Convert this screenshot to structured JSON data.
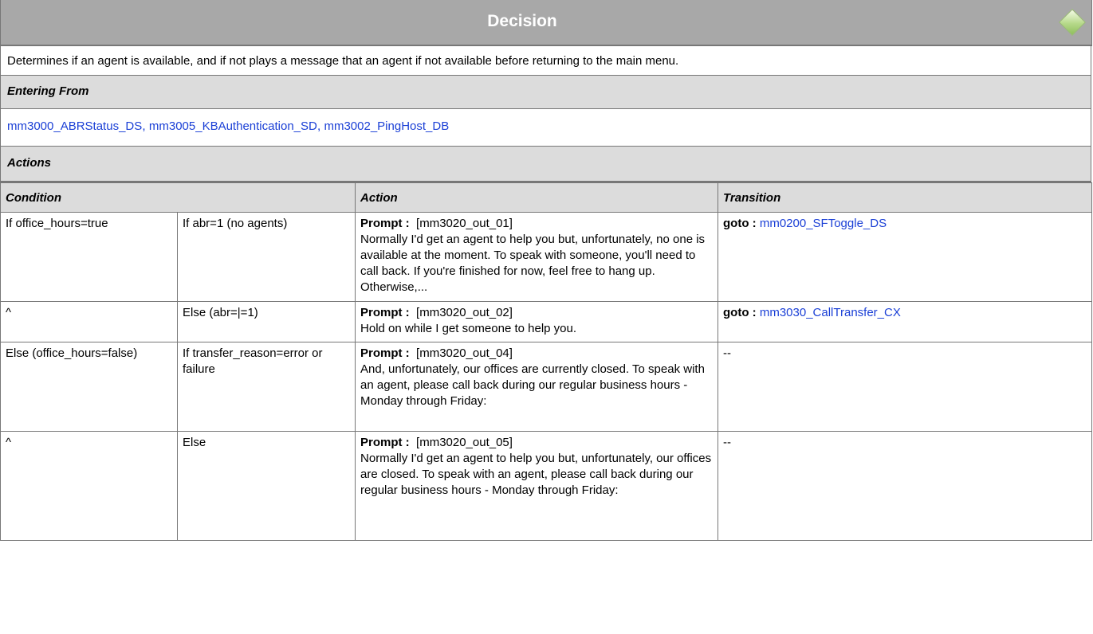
{
  "header": {
    "title": "Decision",
    "icon": "decision-diamond-icon"
  },
  "description": "Determines if an agent is available, and if not plays a message that an agent if not available before returning to the main menu.",
  "entering_from": {
    "label": "Entering From",
    "links": [
      "mm3000_ABRStatus_DS",
      "mm3005_KBAuthentication_SD",
      "mm3002_PingHost_DB"
    ],
    "separator": ","
  },
  "actions": {
    "label": "Actions",
    "columns": {
      "condition": "Condition",
      "action": "Action",
      "transition": "Transition"
    },
    "rows": [
      {
        "cond1": "If office_hours=true",
        "cond2": "If abr=1 (no agents)",
        "prompt_label": "Prompt :",
        "prompt_id": "[mm3020_out_01]",
        "prompt_text": "Normally I'd get an agent to help you but, unfortunately, no one is available at the moment. To speak with someone, you'll need to call back. If you're finished for now, feel free to hang up. Otherwise,...",
        "goto_label": "goto :",
        "goto_target": "mm0200_SFToggle_DS"
      },
      {
        "cond1": "^",
        "cond2": "Else (abr=|=1)",
        "prompt_label": "Prompt :",
        "prompt_id": "[mm3020_out_02]",
        "prompt_text": "Hold on while I get someone to help you.",
        "goto_label": "goto :",
        "goto_target": "mm3030_CallTransfer_CX"
      },
      {
        "cond1": "Else (office_hours=false)",
        "cond2": "If transfer_reason=error or failure",
        "prompt_label": "Prompt :",
        "prompt_id": "[mm3020_out_04]",
        "prompt_text": "And, unfortunately, our offices are currently closed.  To speak with an agent, please call back during our regular business hours - Monday through Friday:",
        "transition": "--"
      },
      {
        "cond1": "^",
        "cond2": "Else",
        "prompt_label": "Prompt :",
        "prompt_id": "[mm3020_out_05]",
        "prompt_text": "Normally I'd get an agent to help you but, unfortunately, our offices are closed. To speak with an agent, please call back during our regular business hours - Monday through Friday:",
        "transition": "--"
      }
    ]
  }
}
